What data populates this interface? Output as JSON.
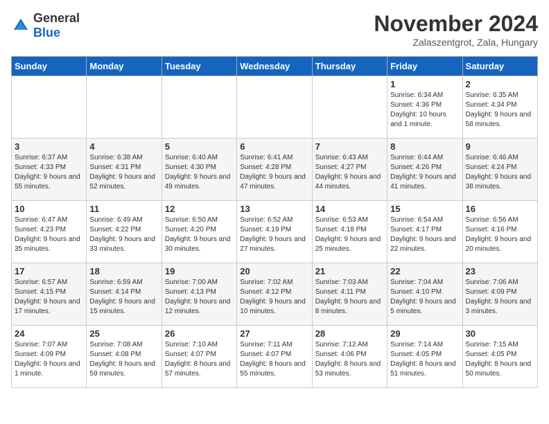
{
  "logo": {
    "general": "General",
    "blue": "Blue"
  },
  "title": "November 2024",
  "subtitle": "Zalaszentgrot, Zala, Hungary",
  "days_of_week": [
    "Sunday",
    "Monday",
    "Tuesday",
    "Wednesday",
    "Thursday",
    "Friday",
    "Saturday"
  ],
  "weeks": [
    [
      {
        "day": "",
        "info": ""
      },
      {
        "day": "",
        "info": ""
      },
      {
        "day": "",
        "info": ""
      },
      {
        "day": "",
        "info": ""
      },
      {
        "day": "",
        "info": ""
      },
      {
        "day": "1",
        "info": "Sunrise: 6:34 AM\nSunset: 4:36 PM\nDaylight: 10 hours and 1 minute."
      },
      {
        "day": "2",
        "info": "Sunrise: 6:35 AM\nSunset: 4:34 PM\nDaylight: 9 hours and 58 minutes."
      }
    ],
    [
      {
        "day": "3",
        "info": "Sunrise: 6:37 AM\nSunset: 4:33 PM\nDaylight: 9 hours and 55 minutes."
      },
      {
        "day": "4",
        "info": "Sunrise: 6:38 AM\nSunset: 4:31 PM\nDaylight: 9 hours and 52 minutes."
      },
      {
        "day": "5",
        "info": "Sunrise: 6:40 AM\nSunset: 4:30 PM\nDaylight: 9 hours and 49 minutes."
      },
      {
        "day": "6",
        "info": "Sunrise: 6:41 AM\nSunset: 4:28 PM\nDaylight: 9 hours and 47 minutes."
      },
      {
        "day": "7",
        "info": "Sunrise: 6:43 AM\nSunset: 4:27 PM\nDaylight: 9 hours and 44 minutes."
      },
      {
        "day": "8",
        "info": "Sunrise: 6:44 AM\nSunset: 4:26 PM\nDaylight: 9 hours and 41 minutes."
      },
      {
        "day": "9",
        "info": "Sunrise: 6:46 AM\nSunset: 4:24 PM\nDaylight: 9 hours and 38 minutes."
      }
    ],
    [
      {
        "day": "10",
        "info": "Sunrise: 6:47 AM\nSunset: 4:23 PM\nDaylight: 9 hours and 35 minutes."
      },
      {
        "day": "11",
        "info": "Sunrise: 6:49 AM\nSunset: 4:22 PM\nDaylight: 9 hours and 33 minutes."
      },
      {
        "day": "12",
        "info": "Sunrise: 6:50 AM\nSunset: 4:20 PM\nDaylight: 9 hours and 30 minutes."
      },
      {
        "day": "13",
        "info": "Sunrise: 6:52 AM\nSunset: 4:19 PM\nDaylight: 9 hours and 27 minutes."
      },
      {
        "day": "14",
        "info": "Sunrise: 6:53 AM\nSunset: 4:18 PM\nDaylight: 9 hours and 25 minutes."
      },
      {
        "day": "15",
        "info": "Sunrise: 6:54 AM\nSunset: 4:17 PM\nDaylight: 9 hours and 22 minutes."
      },
      {
        "day": "16",
        "info": "Sunrise: 6:56 AM\nSunset: 4:16 PM\nDaylight: 9 hours and 20 minutes."
      }
    ],
    [
      {
        "day": "17",
        "info": "Sunrise: 6:57 AM\nSunset: 4:15 PM\nDaylight: 9 hours and 17 minutes."
      },
      {
        "day": "18",
        "info": "Sunrise: 6:59 AM\nSunset: 4:14 PM\nDaylight: 9 hours and 15 minutes."
      },
      {
        "day": "19",
        "info": "Sunrise: 7:00 AM\nSunset: 4:13 PM\nDaylight: 9 hours and 12 minutes."
      },
      {
        "day": "20",
        "info": "Sunrise: 7:02 AM\nSunset: 4:12 PM\nDaylight: 9 hours and 10 minutes."
      },
      {
        "day": "21",
        "info": "Sunrise: 7:03 AM\nSunset: 4:11 PM\nDaylight: 9 hours and 8 minutes."
      },
      {
        "day": "22",
        "info": "Sunrise: 7:04 AM\nSunset: 4:10 PM\nDaylight: 9 hours and 5 minutes."
      },
      {
        "day": "23",
        "info": "Sunrise: 7:06 AM\nSunset: 4:09 PM\nDaylight: 9 hours and 3 minutes."
      }
    ],
    [
      {
        "day": "24",
        "info": "Sunrise: 7:07 AM\nSunset: 4:09 PM\nDaylight: 9 hours and 1 minute."
      },
      {
        "day": "25",
        "info": "Sunrise: 7:08 AM\nSunset: 4:08 PM\nDaylight: 8 hours and 59 minutes."
      },
      {
        "day": "26",
        "info": "Sunrise: 7:10 AM\nSunset: 4:07 PM\nDaylight: 8 hours and 57 minutes."
      },
      {
        "day": "27",
        "info": "Sunrise: 7:11 AM\nSunset: 4:07 PM\nDaylight: 8 hours and 55 minutes."
      },
      {
        "day": "28",
        "info": "Sunrise: 7:12 AM\nSunset: 4:06 PM\nDaylight: 8 hours and 53 minutes."
      },
      {
        "day": "29",
        "info": "Sunrise: 7:14 AM\nSunset: 4:05 PM\nDaylight: 8 hours and 51 minutes."
      },
      {
        "day": "30",
        "info": "Sunrise: 7:15 AM\nSunset: 4:05 PM\nDaylight: 8 hours and 50 minutes."
      }
    ]
  ]
}
